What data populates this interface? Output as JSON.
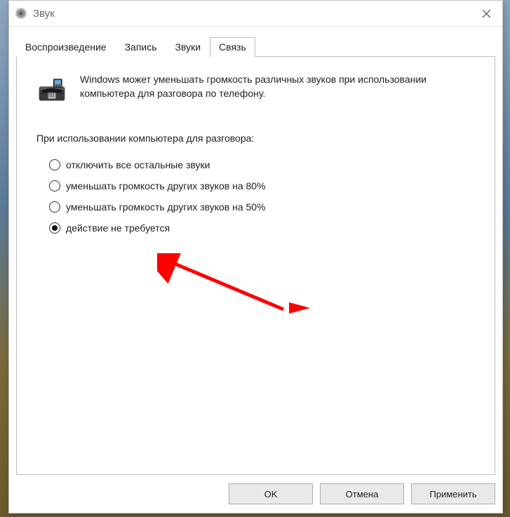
{
  "window": {
    "title": "Звук"
  },
  "tabs": [
    {
      "label": "Воспроизведение",
      "active": false
    },
    {
      "label": "Запись",
      "active": false
    },
    {
      "label": "Звуки",
      "active": false
    },
    {
      "label": "Связь",
      "active": true
    }
  ],
  "intro": {
    "text": "Windows может уменьшать громкость различных звуков при использовании компьютера для разговора по телефону."
  },
  "group": {
    "label": "При использовании компьютера для разговора:"
  },
  "options": [
    {
      "label": "отключить все остальные звуки",
      "selected": false
    },
    {
      "label": "уменьшать громкость других звуков на 80%",
      "selected": false
    },
    {
      "label": "уменьшать громкость других звуков на 50%",
      "selected": false
    },
    {
      "label": "действие не требуется",
      "selected": true
    }
  ],
  "buttons": {
    "ok": "OK",
    "cancel": "Отмена",
    "apply": "Применить"
  }
}
